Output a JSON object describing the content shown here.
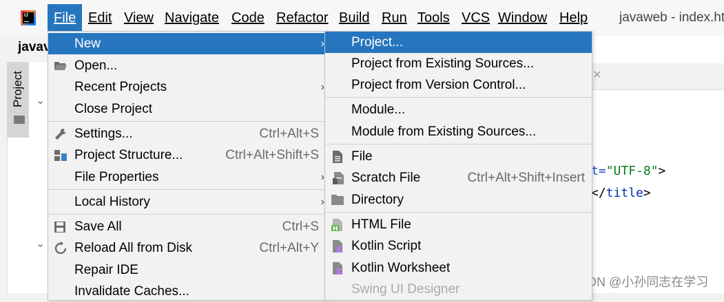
{
  "menubar": {
    "items": [
      "File",
      "Edit",
      "View",
      "Navigate",
      "Code",
      "Refactor",
      "Build",
      "Run",
      "Tools",
      "VCS",
      "Window",
      "Help"
    ],
    "logo_text": "IJ",
    "window_title": "javaweb - index.ht"
  },
  "project": {
    "title": "javav",
    "side_tab": "Project"
  },
  "file_menu": {
    "new": "New",
    "open": "Open...",
    "recent_projects": "Recent Projects",
    "close_project": "Close Project",
    "settings": "Settings...",
    "settings_shortcut": "Ctrl+Alt+S",
    "project_structure": "Project Structure...",
    "project_structure_shortcut": "Ctrl+Alt+Shift+S",
    "file_properties": "File Properties",
    "local_history": "Local History",
    "save_all": "Save All",
    "save_all_shortcut": "Ctrl+S",
    "reload": "Reload All from Disk",
    "reload_shortcut": "Ctrl+Alt+Y",
    "repair_ide": "Repair IDE",
    "invalidate_caches": "Invalidate Caches..."
  },
  "new_menu": {
    "project": "Project...",
    "project_existing": "Project from Existing Sources...",
    "project_vcs": "Project from Version Control...",
    "module": "Module...",
    "module_existing": "Module from Existing Sources...",
    "file": "File",
    "scratch_file": "Scratch File",
    "scratch_shortcut": "Ctrl+Alt+Shift+Insert",
    "directory": "Directory",
    "html_file": "HTML File",
    "kotlin_script": "Kotlin Script",
    "kotlin_worksheet": "Kotlin Worksheet",
    "swing_designer": "Swing UI Designer"
  },
  "editor": {
    "line1_attr": "t=",
    "line1_value": "\"UTF-8\"",
    "line1_end": ">",
    "line2_start": "</",
    "line2_tag": "title",
    "line2_end": ">"
  },
  "watermark": "CSDN @小孙同志在学习",
  "colors": {
    "accent": "#2675bf",
    "menu_bg": "#f2f2f2"
  }
}
